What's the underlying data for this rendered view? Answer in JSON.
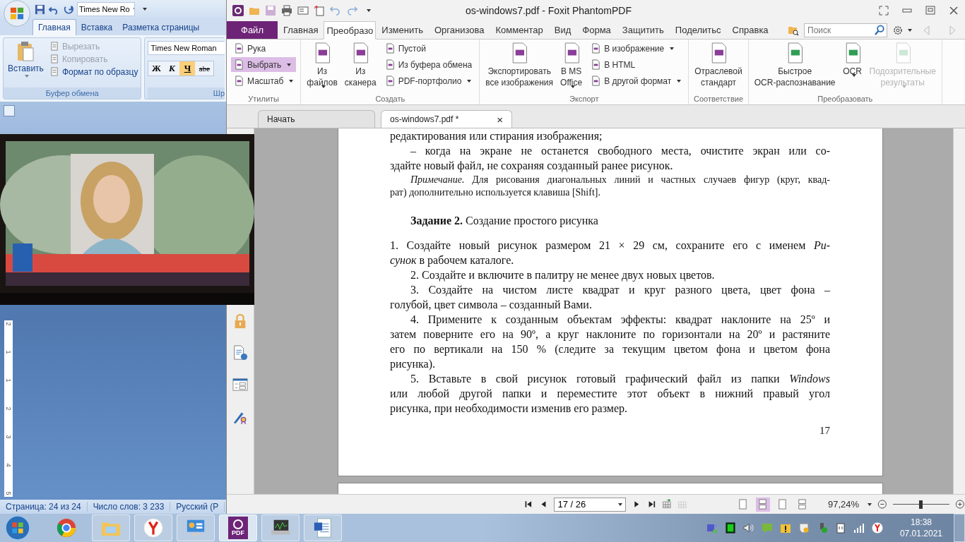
{
  "word": {
    "font_box": "Times New Ro",
    "tabs": [
      {
        "label": "Главная",
        "selected": true
      },
      {
        "label": "Вставка",
        "selected": false
      },
      {
        "label": "Разметка страницы",
        "selected": false
      }
    ],
    "clipboard": {
      "paste": "Вставить",
      "group": "Буфер обмена",
      "items": [
        {
          "label": "Вырезать",
          "disabled": true
        },
        {
          "label": "Копировать",
          "disabled": true
        },
        {
          "label": "Формат по образцу",
          "disabled": false
        }
      ]
    },
    "font": {
      "name": "Times New Roman",
      "group": "Шр",
      "buttons": [
        {
          "label": "Ж",
          "selected": false
        },
        {
          "label": "К",
          "selected": false
        },
        {
          "label": "Ч",
          "selected": true
        },
        {
          "label": "abe",
          "selected": false
        }
      ]
    },
    "ruler_labels": [
      "2",
      "1",
      "1",
      "2",
      "3",
      "4",
      "5"
    ],
    "status_bar": [
      "Страница: 24 из 24",
      "Число слов: 3 233",
      "Русский (Р"
    ]
  },
  "foxit": {
    "title": "os-windows7.pdf - Foxit PhantomPDF",
    "tabs": [
      {
        "label": "Файл",
        "kind": "file",
        "selected": false
      },
      {
        "label": "Главная",
        "kind": "tab",
        "selected": false
      },
      {
        "label": "Преобразо",
        "kind": "tab",
        "selected": true
      },
      {
        "label": "Изменить",
        "kind": "tab",
        "selected": false
      },
      {
        "label": "Организова",
        "kind": "tab",
        "selected": false
      },
      {
        "label": "Комментар",
        "kind": "tab",
        "selected": false
      },
      {
        "label": "Вид",
        "kind": "tab",
        "selected": false
      },
      {
        "label": "Форма",
        "kind": "tab",
        "selected": false
      },
      {
        "label": "Защитить",
        "kind": "tab",
        "selected": false
      },
      {
        "label": "Поделитьс",
        "kind": "tab",
        "selected": false
      },
      {
        "label": "Справка",
        "kind": "tab",
        "selected": false
      }
    ],
    "search": {
      "placeholder": "Поиск"
    },
    "ribbon": [
      {
        "label": "Утилиты",
        "items": [
          {
            "kind": "small",
            "label": "Рука",
            "dropdown": false,
            "selected": false,
            "disabled": false
          },
          {
            "kind": "small",
            "label": "Выбрать",
            "dropdown": true,
            "selected": true,
            "disabled": false
          },
          {
            "kind": "small",
            "label": "Масштаб",
            "dropdown": true,
            "selected": false,
            "disabled": false
          }
        ]
      },
      {
        "label": "Создать",
        "items": [
          {
            "kind": "big",
            "label": "Из\nфайлов",
            "dropdown": true,
            "selected": false,
            "disabled": false
          },
          {
            "kind": "big",
            "label": "Из\nсканера",
            "dropdown": false,
            "selected": false,
            "disabled": false
          },
          {
            "kind": "small",
            "label": "Пустой",
            "dropdown": false,
            "selected": false,
            "disabled": false
          },
          {
            "kind": "small",
            "label": "Из буфера обмена",
            "dropdown": false,
            "selected": false,
            "disabled": false
          },
          {
            "kind": "small",
            "label": "PDF-портфолио",
            "dropdown": true,
            "selected": false,
            "disabled": false
          }
        ]
      },
      {
        "label": "Экспорт",
        "items": [
          {
            "kind": "big",
            "label": "Экспортировать\nвсе изображения",
            "dropdown": false,
            "selected": false,
            "disabled": false
          },
          {
            "kind": "big",
            "label": "В MS\nOffice",
            "dropdown": true,
            "selected": false,
            "disabled": false
          },
          {
            "kind": "small",
            "label": "В изображение",
            "dropdown": true,
            "selected": false,
            "disabled": false
          },
          {
            "kind": "small",
            "label": "В HTML",
            "dropdown": false,
            "selected": false,
            "disabled": false
          },
          {
            "kind": "small",
            "label": "В другой формат",
            "dropdown": true,
            "selected": false,
            "disabled": false
          }
        ]
      },
      {
        "label": "Соответствие",
        "items": [
          {
            "kind": "big",
            "label": "Отраслевой\nстандарт",
            "dropdown": false,
            "selected": false,
            "disabled": false
          }
        ]
      },
      {
        "label": "Преобразовать",
        "items": [
          {
            "kind": "big",
            "label": "Быстрое\nOCR-распознавание",
            "dropdown": false,
            "selected": false,
            "disabled": false
          },
          {
            "kind": "big",
            "label": "OCR",
            "dropdown": true,
            "selected": false,
            "disabled": false
          },
          {
            "kind": "big",
            "label": "Подозрительные\nрезультаты",
            "dropdown": true,
            "selected": false,
            "disabled": true
          }
        ]
      }
    ],
    "doc_tabs": [
      {
        "label": "Начать",
        "selected": false
      },
      {
        "label": "os-windows7.pdf *",
        "selected": true,
        "close": "×"
      }
    ],
    "page": {
      "paragraphs": [
        {
          "kind": "body",
          "indent": false,
          "lines": [
            "редактирования или стирания изображения;"
          ]
        },
        {
          "kind": "body",
          "indent": true,
          "lines": [
            "–   когда на экране не останется свободного места, очистите экран или со-",
            "здайте новый файл, не сохраняя созданный ранее рисунок."
          ]
        },
        {
          "kind": "note",
          "indent": true,
          "lines": [
            "*Примечание.* Для рисования диагональных линий и частных случаев фигур (круг, квад-",
            "рат) дополнительно используется клавиша [Shift]."
          ]
        },
        {
          "kind": "heading",
          "indent": true,
          "lines": [
            "**Задание 2.** Создание простого рисунка"
          ]
        },
        {
          "kind": "body",
          "indent": false,
          "lines": [
            "1.   Создайте новый рисунок размером 21 × 29 см, сохраните его с именем *Ри-*",
            "*сунок* в рабочем каталоге."
          ]
        },
        {
          "kind": "body",
          "indent": true,
          "lines": [
            "2.   Создайте и включите в палитру не менее двух новых цветов."
          ]
        },
        {
          "kind": "body",
          "indent": true,
          "lines": [
            "3.   Создайте на чистом листе квадрат и круг разного цвета, цвет фона –",
            "голубой, цвет символа – созданный Вами."
          ]
        },
        {
          "kind": "body",
          "indent": true,
          "lines": [
            "4.   Примените к созданным объектам эффекты: квадрат наклоните на 25º и",
            "затем поверните его на 90º, а круг наклоните по горизонтали на 20º и растяните",
            "его по вертикали на 150 % (следите за текущим цветом фона и цветом фона",
            "рисунка)."
          ]
        },
        {
          "kind": "body",
          "indent": true,
          "lines": [
            "5.   Вставьте в свой рисунок готовый графический файл из папки *Windows*",
            "или любой другой папки и переместите этот объект в нижний правый угол",
            "рисунка, при необходимости изменив его размер."
          ]
        }
      ],
      "page_number": "17"
    },
    "status_bar": {
      "page_field": "17 / 26",
      "view_modes": [
        {
          "selected": false
        },
        {
          "selected": true
        },
        {
          "selected": false
        },
        {
          "selected": false
        }
      ],
      "zoom": "97,24%",
      "zoom_slider": {
        "level": 0.49
      }
    }
  },
  "taskbar": {
    "apps": [
      {
        "kind": "chrome",
        "selected": false
      },
      {
        "kind": "folder",
        "selected": false
      },
      {
        "kind": "yandex",
        "selected": false
      },
      {
        "kind": "panel",
        "selected": false
      },
      {
        "kind": "pdf",
        "selected": true,
        "label": "PDF"
      },
      {
        "kind": "monitor",
        "selected": false
      },
      {
        "kind": "word",
        "selected": false
      }
    ],
    "clock": {
      "time": "18:38",
      "date": "07.01.2021"
    }
  }
}
